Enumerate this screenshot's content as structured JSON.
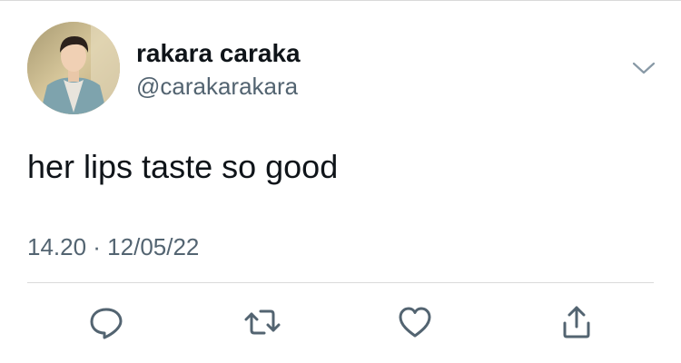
{
  "tweet": {
    "author": {
      "display_name": "rakara caraka",
      "handle": "@carakarakara"
    },
    "text": "her lips taste so good",
    "timestamp": "14.20 · 12/05/22"
  },
  "icons": {
    "more": "chevron-down-icon",
    "reply": "reply-icon",
    "retweet": "retweet-icon",
    "like": "heart-icon",
    "share": "share-icon"
  },
  "colors": {
    "primary_text": "#0f1419",
    "secondary_text": "#536471",
    "icon": "#536471",
    "divider": "#dadada"
  }
}
